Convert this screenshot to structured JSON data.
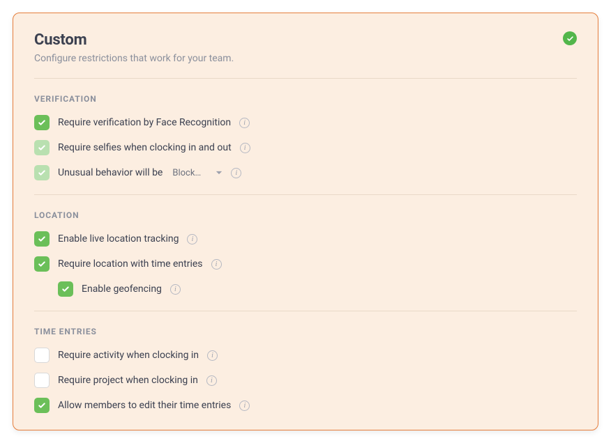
{
  "header": {
    "title": "Custom",
    "subtitle": "Configure restrictions that work for your team."
  },
  "sections": {
    "verification": {
      "header": "VERIFICATION",
      "items": {
        "face_recognition": "Require verification by Face Recognition",
        "selfies": "Require selfies when clocking in and out",
        "unusual_prefix": "Unusual behavior will be",
        "unusual_value": "Block..."
      }
    },
    "location": {
      "header": "LOCATION",
      "items": {
        "live_tracking": "Enable live location tracking",
        "require_location": "Require location with time entries",
        "geofencing": "Enable geofencing"
      }
    },
    "time_entries": {
      "header": "TIME ENTRIES",
      "items": {
        "require_activity": "Require activity when clocking in",
        "require_project": "Require project when clocking in",
        "allow_edit": "Allow members to edit their time entries"
      }
    }
  }
}
